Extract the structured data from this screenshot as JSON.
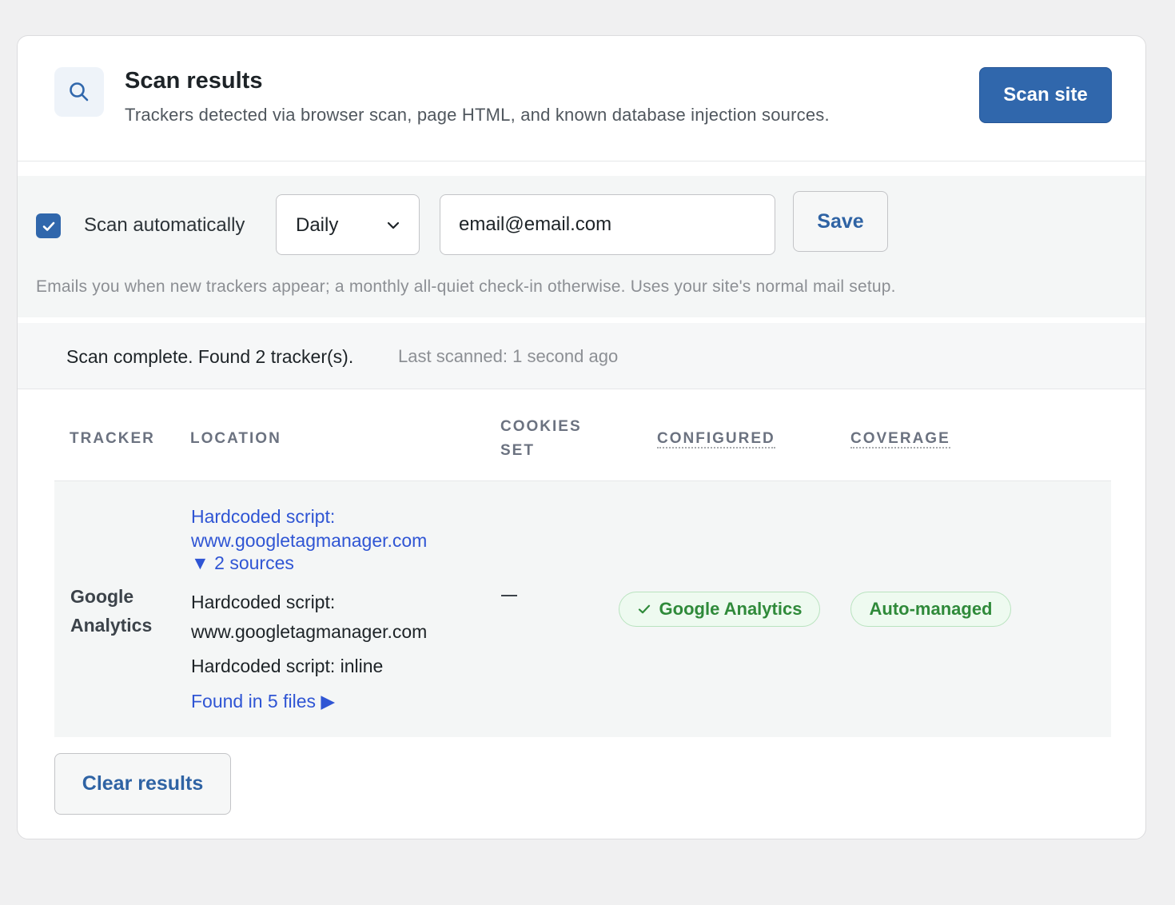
{
  "header": {
    "title": "Scan results",
    "subtitle": "Trackers detected via browser scan, page HTML, and known database injection sources.",
    "scan_button": "Scan site",
    "icon": "search-icon"
  },
  "auto_scan": {
    "checked": true,
    "label": "Scan automatically",
    "frequency": "Daily",
    "email_value": "email@email.com",
    "save_label": "Save",
    "help_text": "Emails you when new trackers appear; a monthly all-quiet check-in otherwise. Uses your site's normal mail setup."
  },
  "status": {
    "message": "Scan complete. Found 2 tracker(s).",
    "last_scanned": "Last scanned: 1 second ago"
  },
  "table": {
    "headers": {
      "tracker": "TRACKER",
      "location": "LOCATION",
      "cookies_line1": "COOKIES",
      "cookies_line2": "SET",
      "configured": "CONFIGURED",
      "coverage": "COVERAGE"
    },
    "rows": [
      {
        "tracker_line1": "Google",
        "tracker_line2": "Analytics",
        "location_link_line1": "Hardcoded script:",
        "location_link_line2": "www.googletagmanager.com",
        "sources_toggle": "▼ 2 sources",
        "source1_line1": "Hardcoded script:",
        "source1_line2": "www.googletagmanager.com",
        "source2": "Hardcoded script: inline",
        "found_in": "Found in 5 files ▶",
        "cookies": "—",
        "configured": "Google Analytics",
        "coverage": "Auto-managed"
      }
    ]
  },
  "footer": {
    "clear_label": "Clear results"
  },
  "colors": {
    "primary": "#3067ac",
    "link": "#2f55d4",
    "success": "#2f8a3a"
  }
}
